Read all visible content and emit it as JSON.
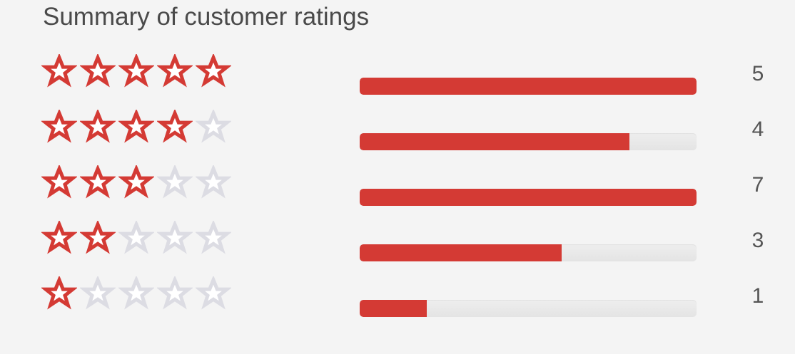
{
  "summary": {
    "title": "Summary of customer ratings",
    "accent_color": "#d43a34",
    "empty_star_color": "#dcdce3",
    "rows": [
      {
        "stars": 5,
        "count": "5",
        "fill_fraction": 1.0
      },
      {
        "stars": 4,
        "count": "4",
        "fill_fraction": 0.8
      },
      {
        "stars": 3,
        "count": "7",
        "fill_fraction": 1.0
      },
      {
        "stars": 2,
        "count": "3",
        "fill_fraction": 0.6
      },
      {
        "stars": 1,
        "count": "1",
        "fill_fraction": 0.2
      }
    ]
  }
}
